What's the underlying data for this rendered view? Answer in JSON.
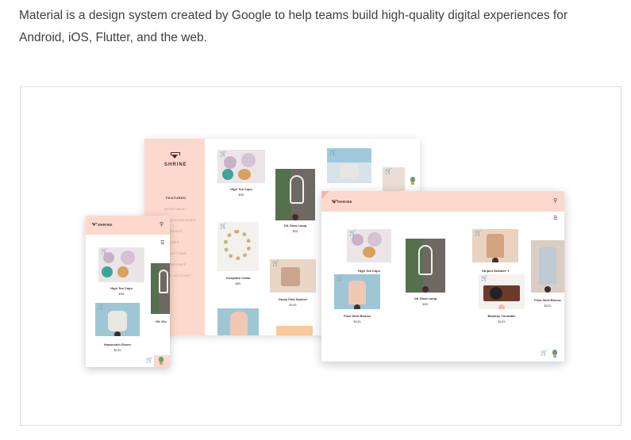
{
  "intro": {
    "line1": "Material is a design system created by Google to help teams build high-quality digital experiences for",
    "line2": "Android, iOS, Flutter, and the web."
  },
  "brand": "SHRINE",
  "colors": {
    "pink": "#fdd9cd",
    "brown": "#442c2e",
    "accent": "#f2b9ae"
  },
  "tablet": {
    "nav": [
      "FEATURED",
      "APARTMENT",
      "ACCESSORIES",
      "SHOES",
      "TOPS",
      "BOTTOMS",
      "DRESSES",
      "MY ACCOUNT"
    ],
    "products": [
      {
        "title": "High Tea Cups",
        "price": "$36"
      },
      {
        "title": "OK Glow Lamp",
        "price": "$20"
      },
      {
        "title": "Cleopatra Collar",
        "price": "$80"
      },
      {
        "title": "Dusty Pink Satchel",
        "price": "$133"
      }
    ]
  },
  "phone": {
    "products": [
      {
        "title": "High Tea Cups",
        "price": "$36"
      },
      {
        "title": "OK Glo",
        "price": ""
      },
      {
        "title": "Hopscotch Shoes",
        "price": "$133"
      }
    ]
  },
  "desktop": {
    "products": [
      {
        "title": "High Tea Cups",
        "price": "$36"
      },
      {
        "title": "OK Glow Lamp",
        "price": "$20"
      },
      {
        "title": "Striped Sweater~f",
        "price": "$154"
      },
      {
        "title": "Flow Shirt Blouse",
        "price": "$220"
      },
      {
        "title": "Flow Shirt Blouse",
        "price": "$133"
      },
      {
        "title": "Bamboo Turntable",
        "price": "$133"
      }
    ]
  },
  "icons": [
    "search-icon",
    "filter-icon",
    "cart-icon",
    "plant-icon",
    "diamond-logo-icon"
  ]
}
